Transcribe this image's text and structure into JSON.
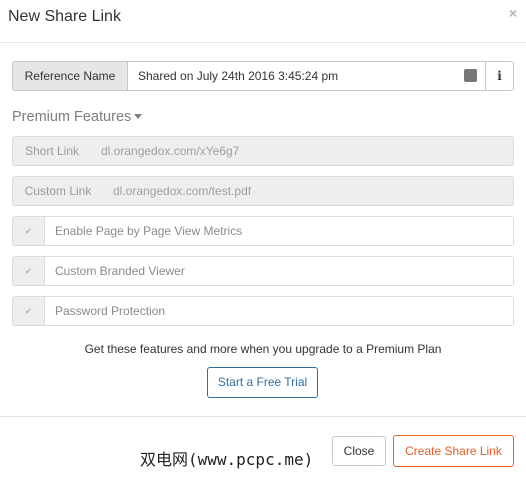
{
  "dialog": {
    "title": "New Share Link",
    "close_icon": "close-icon"
  },
  "reference": {
    "label": "Reference Name",
    "value": "Shared on July 24th 2016 3:45:24 pm",
    "field_icon": "ellipsis-icon",
    "info_label": "i"
  },
  "premium": {
    "heading": "Premium Features",
    "short_link": {
      "label": "Short Link",
      "value": "dl.orangedox.com/xYe6g7"
    },
    "custom_link": {
      "label": "Custom Link",
      "value": "dl.orangedox.com/test.pdf"
    },
    "options": [
      {
        "label": "Enable Page by Page View Metrics",
        "checked": true
      },
      {
        "label": "Custom Branded Viewer",
        "checked": true
      },
      {
        "label": "Password Protection",
        "checked": true
      }
    ],
    "check_mark": "✔",
    "upgrade_text": "Get these features and more when you upgrade to a Premium Plan",
    "trial_button": "Start a Free Trial"
  },
  "footer": {
    "watermark": "双电网(www.pcpc.me)",
    "close_button": "Close",
    "create_button": "Create Share Link"
  },
  "colors": {
    "accent_orange": "#e0622a",
    "link_blue": "#2f6e9e"
  }
}
